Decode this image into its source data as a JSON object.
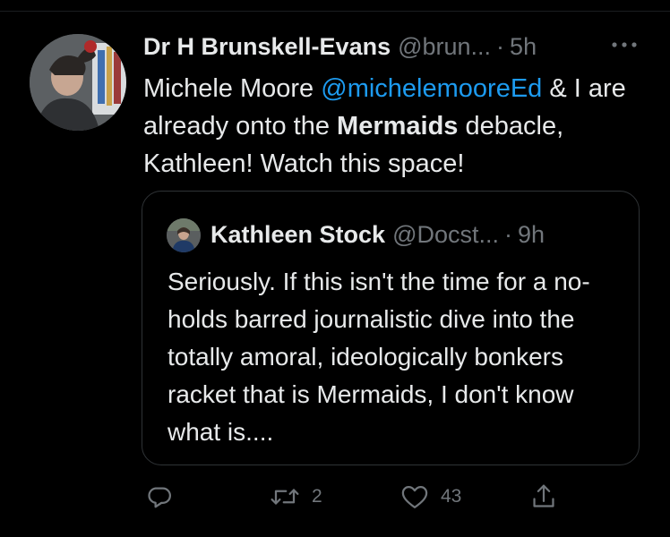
{
  "tweet": {
    "author_name": "Dr H Brunskell-Evans",
    "author_handle": "@brun...",
    "separator": "·",
    "time": "5h",
    "more_icon": "more-dots-icon",
    "text": {
      "part1": "Michele Moore ",
      "mention": "@michelemooreEd",
      "part2": " & I are already onto the ",
      "bold": "Mermaids",
      "part3": " debacle, Kathleen!  Watch this space!"
    }
  },
  "quoted_tweet": {
    "author_name": "Kathleen Stock",
    "author_handle": "@Docst...",
    "separator": "·",
    "time": "9h",
    "text": "Seriously. If this isn't the time for a no-holds barred journalistic dive into the totally amoral, ideologically bonkers racket that is Mermaids, I don't know what is...."
  },
  "actions": {
    "reply": {
      "icon": "reply-icon",
      "count": ""
    },
    "retweet": {
      "icon": "retweet-icon",
      "count": "2"
    },
    "like": {
      "icon": "heart-icon",
      "count": "43"
    },
    "share": {
      "icon": "share-icon",
      "count": ""
    }
  },
  "colors": {
    "background": "#000000",
    "text": "#e7e9ea",
    "secondary": "#71767b",
    "link": "#1d9bf0",
    "border": "#2f3336"
  }
}
